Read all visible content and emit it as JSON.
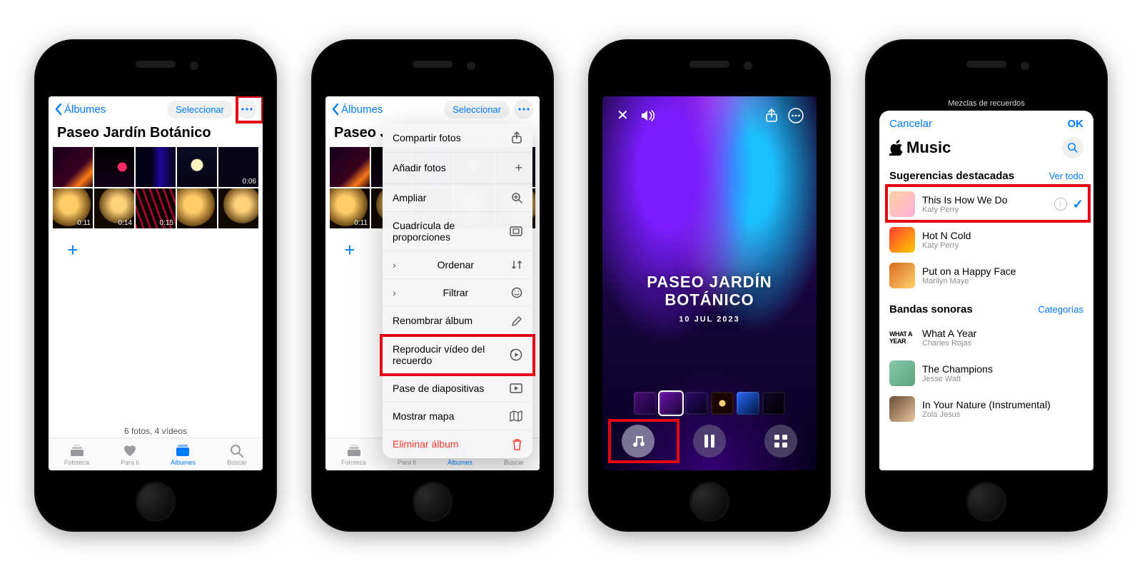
{
  "colors": {
    "accent": "#007aff",
    "danger": "#ff3b30",
    "highlight": "#e30613"
  },
  "shared": {
    "backLabel": "Álbumes",
    "selectLabel": "Seleccionar",
    "albumTitle": "Paseo Jardín Botánico",
    "countLabel": "6 fotos, 4 vídeos",
    "tabs": {
      "fototeca": "Fototeca",
      "paraTi": "Para ti",
      "albumes": "Álbumes",
      "buscar": "Buscar"
    },
    "durations": [
      "0:06",
      "0:11",
      "0:14",
      "0:15"
    ]
  },
  "menu": {
    "items": [
      {
        "label": "Compartir fotos",
        "icon": "share"
      },
      {
        "label": "Añadir fotos",
        "icon": "plus"
      },
      {
        "label": "Ampliar",
        "icon": "zoom"
      },
      {
        "label": "Cuadrícula de proporciones",
        "icon": "aspect"
      },
      {
        "label": "Ordenar",
        "icon": "sort",
        "sub": true
      },
      {
        "label": "Filtrar",
        "icon": "filter",
        "sub": true
      },
      {
        "label": "Renombrar álbum",
        "icon": "pencil"
      },
      {
        "label": "Reproducir vídeo del recuerdo",
        "icon": "playMemory",
        "highlighted": true
      },
      {
        "label": "Pase de diapositivas",
        "icon": "slideshow"
      },
      {
        "label": "Mostrar mapa",
        "icon": "map"
      },
      {
        "label": "Eliminar álbum",
        "icon": "trash",
        "danger": true
      }
    ]
  },
  "memory": {
    "titleLine1": "PASEO JARDÍN",
    "titleLine2": "BOTÁNICO",
    "date": "10 JUL 2023"
  },
  "music": {
    "behindTitle": "Mezclas de recuerdos",
    "cancel": "Cancelar",
    "ok": "OK",
    "brand": "Music",
    "section1": {
      "title": "Sugerencias destacadas",
      "link": "Ver todo"
    },
    "section2": {
      "title": "Bandas sonoras",
      "link": "Categorías"
    },
    "songs1": [
      {
        "title": "This Is How We Do",
        "artist": "Katy Perry",
        "selected": true,
        "highlighted": true
      },
      {
        "title": "Hot N Cold",
        "artist": "Katy Perry"
      },
      {
        "title": "Put on a Happy Face",
        "artist": "Marilyn Maye"
      }
    ],
    "songs2": [
      {
        "title": "What A Year",
        "artist": "Charles Rojas",
        "artLabel": "WHAT A YEAR"
      },
      {
        "title": "The Champions",
        "artist": "Jesse Watt"
      },
      {
        "title": "In Your Nature (Instrumental)",
        "artist": "Zola Jesus"
      }
    ]
  }
}
